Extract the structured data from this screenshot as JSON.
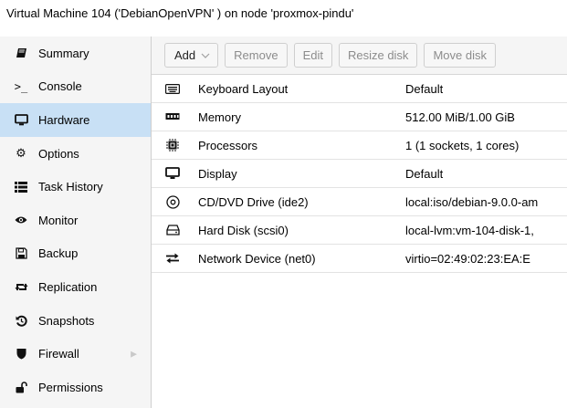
{
  "window": {
    "title": "Virtual Machine 104 ('DebianOpenVPN' ) on node 'proxmox-pindu'"
  },
  "sidebar": {
    "items": [
      {
        "label": "Summary",
        "icon": "book-icon",
        "active": false
      },
      {
        "label": "Console",
        "icon": "terminal-icon",
        "active": false
      },
      {
        "label": "Hardware",
        "icon": "monitor-icon",
        "active": true
      },
      {
        "label": "Options",
        "icon": "gear-icon",
        "active": false
      },
      {
        "label": "Task History",
        "icon": "list-icon",
        "active": false
      },
      {
        "label": "Monitor",
        "icon": "eye-icon",
        "active": false
      },
      {
        "label": "Backup",
        "icon": "floppy-icon",
        "active": false
      },
      {
        "label": "Replication",
        "icon": "retweet-icon",
        "active": false
      },
      {
        "label": "Snapshots",
        "icon": "history-icon",
        "active": false
      },
      {
        "label": "Firewall",
        "icon": "shield-icon",
        "active": false,
        "has_submenu": true
      },
      {
        "label": "Permissions",
        "icon": "unlock-icon",
        "active": false
      }
    ]
  },
  "toolbar": {
    "add_label": "Add",
    "remove_label": "Remove",
    "edit_label": "Edit",
    "resize_label": "Resize disk",
    "move_label": "Move disk"
  },
  "hardware": {
    "rows": [
      {
        "icon": "keyboard-icon",
        "label": "Keyboard Layout",
        "value": "Default"
      },
      {
        "icon": "memory-icon",
        "label": "Memory",
        "value": "512.00 MiB/1.00 GiB"
      },
      {
        "icon": "cpu-icon",
        "label": "Processors",
        "value": "1 (1 sockets, 1 cores)"
      },
      {
        "icon": "display-icon",
        "label": "Display",
        "value": "Default"
      },
      {
        "icon": "cdrom-icon",
        "label": "CD/DVD Drive (ide2)",
        "value": "local:iso/debian-9.0.0-am"
      },
      {
        "icon": "harddisk-icon",
        "label": "Hard Disk (scsi0)",
        "value": "local-lvm:vm-104-disk-1,"
      },
      {
        "icon": "network-icon",
        "label": "Network Device (net0)",
        "value": "virtio=02:49:02:23:EA:E"
      }
    ]
  }
}
